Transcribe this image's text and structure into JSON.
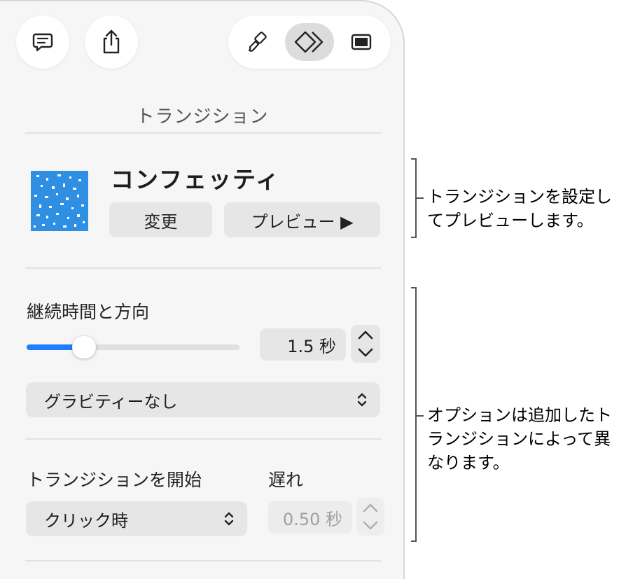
{
  "panel": {
    "title": "トランジション",
    "toolbar": {
      "comment_icon": "comment-icon",
      "share_icon": "share-icon",
      "format_icon": "paintbrush-icon",
      "animate_icon": "animate-icon",
      "document_icon": "document-icon"
    },
    "transition": {
      "name": "コンフェッティ",
      "change_label": "変更",
      "preview_label": "プレビュー ▶"
    },
    "duration": {
      "heading": "継続時間と方向",
      "value": "1.5 秒",
      "slider_fraction": 0.27,
      "gravity_popup": "グラビティーなし"
    },
    "start": {
      "heading": "トランジションを開始",
      "trigger_popup": "クリック時",
      "delay_heading": "遅れ",
      "delay_value": "0.50 秒"
    }
  },
  "callouts": {
    "first": [
      "トランジションを設定し",
      "てプレビューします。"
    ],
    "second": [
      "オプションは追加したト",
      "ランジションによって異",
      "なります。"
    ]
  },
  "colors": {
    "accent": "#1f7dff",
    "thumbnail_blue": "#2f8fe3"
  }
}
